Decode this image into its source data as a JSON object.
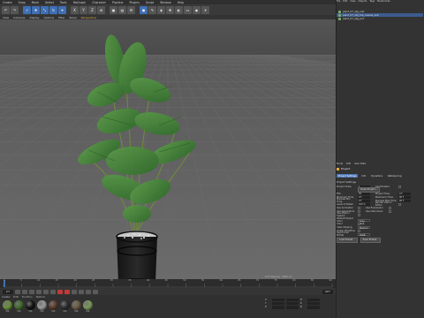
{
  "menu": [
    "Create",
    "Snap",
    "Mesh",
    "Select",
    "Tools",
    "MoGraph",
    "Character",
    "Pipeline",
    "Plugins",
    "Script",
    "Window",
    "Help"
  ],
  "viewport": {
    "menu": [
      "View",
      "Cameras",
      "Display",
      "Options",
      "Filter",
      "Panel"
    ],
    "active_menu": "Perspective",
    "label": "Perspective"
  },
  "status": "Grid Spacing : 1000 cm",
  "timeline": {
    "ticks": [
      "0",
      "5",
      "10",
      "15",
      "20",
      "25",
      "30",
      "35",
      "40",
      "45",
      "50",
      "55",
      "60",
      "65",
      "70",
      "75",
      "80",
      "85",
      "90"
    ],
    "frame_start": "0 F",
    "frame_end": "90 F"
  },
  "materials": {
    "tabs": [
      "Create",
      "Edit",
      "Function",
      "Texture"
    ],
    "items": [
      {
        "label": "Mat",
        "color": "#6a8f3a"
      },
      {
        "label": "Mat",
        "color": "#3f6b2a"
      },
      {
        "label": "Mat",
        "color": "#141414"
      },
      {
        "label": "Mat",
        "color": "#9a9a9a"
      },
      {
        "label": "Mat",
        "color": "#5b3b2a"
      },
      {
        "label": "Mat",
        "color": "#2e2e2e"
      },
      {
        "label": "Mat",
        "color": "#6b5a45"
      },
      {
        "label": "Mat",
        "color": "#7a9a5a"
      }
    ]
  },
  "coords": {
    "rows": [
      {
        "axis": "X",
        "label": "H"
      },
      {
        "axis": "Y",
        "label": "P"
      },
      {
        "axis": "Z",
        "label": "B"
      }
    ]
  },
  "right": {
    "menu": [
      "File",
      "Edit",
      "View",
      "Objects",
      "Tags",
      "Bookmarks"
    ],
    "objects": [
      {
        "name": "plant_07_stg_inst",
        "selected": false
      },
      {
        "name": "plant_07_stg_top_leaves_sub",
        "selected": true
      },
      {
        "name": "plant_07_stg_pot",
        "selected": false
      }
    ],
    "attr_menu": [
      "Mode",
      "Edit",
      "User Data"
    ],
    "attr_title": "Project",
    "attr_tabs": [
      "Project Settings",
      "Info",
      "Dynamics",
      "Referencing"
    ],
    "attr_active_tab": "Project Settings",
    "section": "Project Settings",
    "rows": [
      {
        "label": "Project Scale",
        "value": "1",
        "label2": "Centimeters",
        "value2": ""
      },
      {
        "label": "",
        "value": "Scale Project...",
        "label2": "",
        "value2": ""
      },
      {
        "label": "FPS",
        "value": "30",
        "label2": "Project Time",
        "value2": "0 F"
      },
      {
        "label": "Minimum Time",
        "value": "0 F",
        "label2": "Maximum Time",
        "value2": "90 F"
      },
      {
        "label": "Preview Min Time",
        "value": "0 F",
        "label2": "Preview Max Time",
        "value2": "90 F"
      },
      {
        "label": "Level of Detail",
        "value": "100 %",
        "label2": "Render LOD in Editor",
        "value2": ""
      },
      {
        "label": "Use Animation",
        "value": "",
        "label2": "Use Expression",
        "value2": ""
      },
      {
        "label": "Use Generators",
        "value": "",
        "label2": "Use Deformers",
        "value2": ""
      },
      {
        "label": "Use Motion System",
        "value": "",
        "label2": "",
        "value2": ""
      }
    ],
    "rows2": [
      {
        "label": "Default Object Color",
        "value": "Gray-Blue"
      },
      {
        "label": "Color",
        "value": ""
      },
      {
        "label": "View Clipping",
        "value": "Medium"
      },
      {
        "label": "Linear Workflow",
        "value": ""
      },
      {
        "label": "Input Color Profile",
        "value": "sRGB"
      }
    ],
    "buttons": [
      "Load Preset...",
      "Save Preset..."
    ]
  }
}
